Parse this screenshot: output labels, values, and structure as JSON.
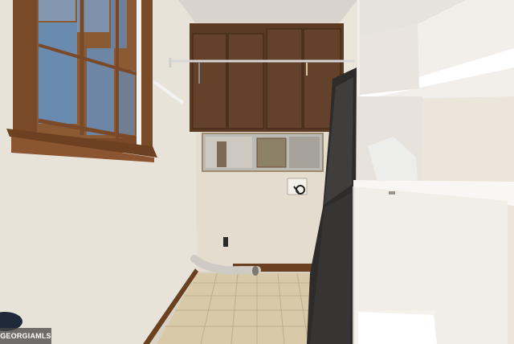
{
  "photo": {
    "subject": "laundry-room",
    "watermark": "GEORGIAMLS"
  },
  "colors": {
    "wall": "#e6e1d6",
    "ceiling": "#d6d2cb",
    "cabinet": "#5a3a22",
    "window_trim": "#7a4a28",
    "floor_tile": "#d8c9a8",
    "shelving": "#f5f3ee",
    "baseboard": "#6b4020"
  }
}
